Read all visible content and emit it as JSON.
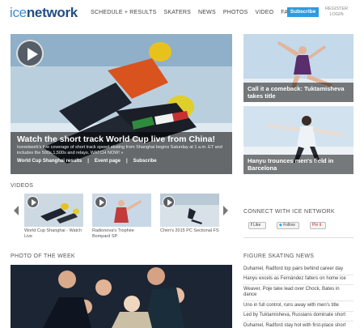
{
  "header": {
    "logo_ice": "ice",
    "logo_network": "network",
    "nav": [
      "SCHEDULE + RESULTS",
      "SKATERS",
      "NEWS",
      "PHOTOS",
      "VIDEO",
      "FANS"
    ],
    "subscribe": "Subscribe",
    "register": "REGISTER",
    "login": "LOGIN"
  },
  "hero": {
    "title": "Watch the short track World Cup live from China!",
    "desc": "Icenetwork's live coverage of short track speed skating from Shanghai begins Saturday at 1 a.m. ET and includes the 500s,1,500s and relays. WATCH NOW! »",
    "links": [
      "World Cup Shanghai results",
      "|",
      "Event page",
      "|",
      "Subscribe"
    ]
  },
  "side_stories": [
    {
      "title": "Call it a comeback: Tuktamisheva takes title"
    },
    {
      "title": "Hanyu trounces men's field in Barcelona"
    }
  ],
  "videos": {
    "heading": "VIDEOS",
    "items": [
      {
        "caption": "World Cup Shanghai - Watch Live"
      },
      {
        "caption": "Radionova's Trophée Bompard SP"
      },
      {
        "caption": "Chen's 2015 PC Sectional FS"
      }
    ]
  },
  "connect": {
    "heading": "CONNECT WITH ICE NETWORK",
    "like": "Like",
    "follow": "Follow",
    "pin": "Pin it"
  },
  "photo_week": {
    "heading": "PHOTO OF THE WEEK"
  },
  "figure_news": {
    "heading": "FIGURE SKATING NEWS",
    "items": [
      "Duhamel, Radford top pairs behind career day",
      "Hanyu excels as Fernández falters on home ice",
      "Weaver, Poje take lead over Chock, Bates in dance",
      "Uno in full control, runs away with men's title",
      "Led by Tuktamisheva, Russians dominate short",
      "Duhamel, Radford stay hot with first-place short"
    ]
  },
  "colors": {
    "logo_ice": "#3a8fd0",
    "logo_network": "#1f4f86",
    "subscribe_bg": "#2a9de0"
  }
}
